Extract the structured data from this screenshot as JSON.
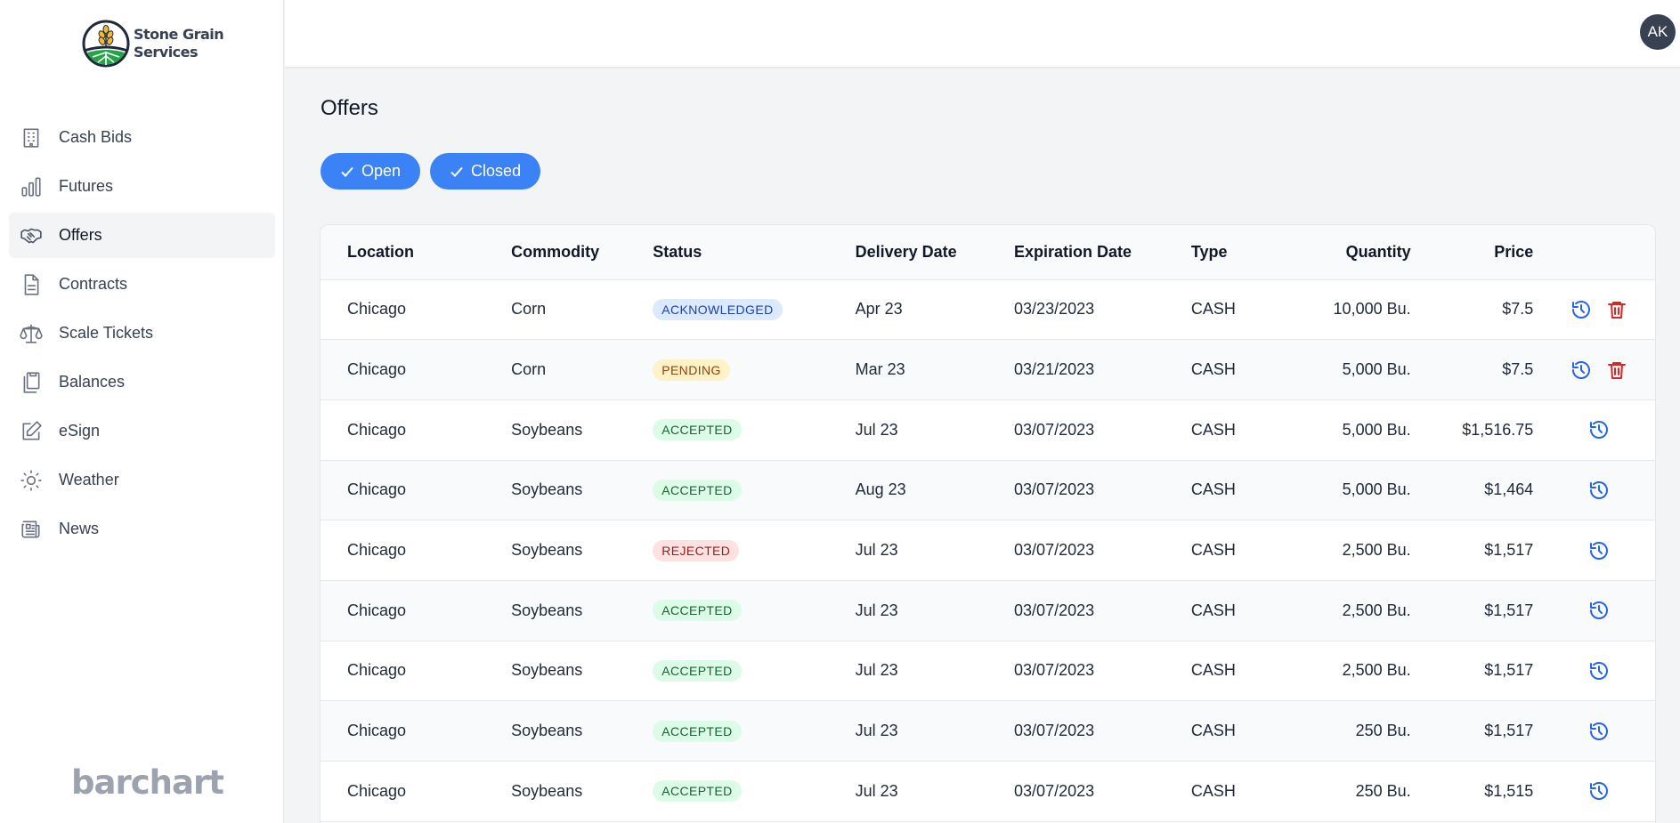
{
  "brand": {
    "line1": "Stone Grain",
    "line2": "Services",
    "footer_logo": "barchart"
  },
  "user": {
    "initials": "AK"
  },
  "sidebar": {
    "items": [
      {
        "label": "Cash Bids",
        "icon": "building-icon"
      },
      {
        "label": "Futures",
        "icon": "bar-chart-icon"
      },
      {
        "label": "Offers",
        "icon": "handshake-icon",
        "active": true
      },
      {
        "label": "Contracts",
        "icon": "document-icon"
      },
      {
        "label": "Scale Tickets",
        "icon": "scale-icon"
      },
      {
        "label": "Balances",
        "icon": "clipboard-icon"
      },
      {
        "label": "eSign",
        "icon": "pencil-square-icon"
      },
      {
        "label": "Weather",
        "icon": "sun-icon"
      },
      {
        "label": "News",
        "icon": "newspaper-icon"
      }
    ]
  },
  "page": {
    "title": "Offers"
  },
  "filters": {
    "open": "Open",
    "closed": "Closed"
  },
  "table": {
    "headers": {
      "location": "Location",
      "commodity": "Commodity",
      "status": "Status",
      "delivery": "Delivery Date",
      "expiration": "Expiration Date",
      "type": "Type",
      "quantity": "Quantity",
      "price": "Price"
    },
    "rows": [
      {
        "location": "Chicago",
        "commodity": "Corn",
        "status": "ACKNOWLEDGED",
        "delivery": "Apr 23",
        "expiration": "03/23/2023",
        "type": "CASH",
        "quantity": "10,000 Bu.",
        "price": "$7.5",
        "deletable": true
      },
      {
        "location": "Chicago",
        "commodity": "Corn",
        "status": "PENDING",
        "delivery": "Mar 23",
        "expiration": "03/21/2023",
        "type": "CASH",
        "quantity": "5,000 Bu.",
        "price": "$7.5",
        "deletable": true
      },
      {
        "location": "Chicago",
        "commodity": "Soybeans",
        "status": "ACCEPTED",
        "delivery": "Jul 23",
        "expiration": "03/07/2023",
        "type": "CASH",
        "quantity": "5,000 Bu.",
        "price": "$1,516.75",
        "deletable": false
      },
      {
        "location": "Chicago",
        "commodity": "Soybeans",
        "status": "ACCEPTED",
        "delivery": "Aug 23",
        "expiration": "03/07/2023",
        "type": "CASH",
        "quantity": "5,000 Bu.",
        "price": "$1,464",
        "deletable": false
      },
      {
        "location": "Chicago",
        "commodity": "Soybeans",
        "status": "REJECTED",
        "delivery": "Jul 23",
        "expiration": "03/07/2023",
        "type": "CASH",
        "quantity": "2,500 Bu.",
        "price": "$1,517",
        "deletable": false
      },
      {
        "location": "Chicago",
        "commodity": "Soybeans",
        "status": "ACCEPTED",
        "delivery": "Jul 23",
        "expiration": "03/07/2023",
        "type": "CASH",
        "quantity": "2,500 Bu.",
        "price": "$1,517",
        "deletable": false
      },
      {
        "location": "Chicago",
        "commodity": "Soybeans",
        "status": "ACCEPTED",
        "delivery": "Jul 23",
        "expiration": "03/07/2023",
        "type": "CASH",
        "quantity": "2,500 Bu.",
        "price": "$1,517",
        "deletable": false
      },
      {
        "location": "Chicago",
        "commodity": "Soybeans",
        "status": "ACCEPTED",
        "delivery": "Jul 23",
        "expiration": "03/07/2023",
        "type": "CASH",
        "quantity": "250 Bu.",
        "price": "$1,517",
        "deletable": false
      },
      {
        "location": "Chicago",
        "commodity": "Soybeans",
        "status": "ACCEPTED",
        "delivery": "Jul 23",
        "expiration": "03/07/2023",
        "type": "CASH",
        "quantity": "250 Bu.",
        "price": "$1,515",
        "deletable": false
      }
    ]
  },
  "colors": {
    "accent": "#3b82f6",
    "history_icon": "#2563eb",
    "delete_icon": "#dc2626",
    "sidebar_active": "#f3f4f6"
  }
}
